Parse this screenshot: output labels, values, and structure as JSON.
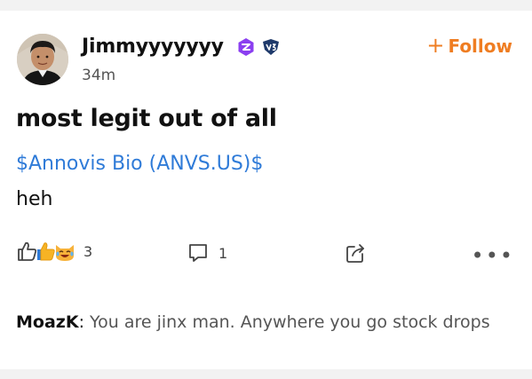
{
  "post": {
    "author": {
      "name": "Jimmyyyyyyy",
      "time": "34m",
      "badges": [
        "verified-badge-icon",
        "level-badge-icon"
      ]
    },
    "follow_label": "Follow",
    "title": "most legit out of all",
    "ticker": "$Annovis Bio (ANVS.US)$",
    "body": "heh",
    "reactions": {
      "count": "3",
      "icons": [
        "thumbs-up-outline-icon",
        "thumbs-up-emoji-icon",
        "laughing-cat-emoji-icon"
      ]
    },
    "comments": {
      "count": "1"
    },
    "top_comment": {
      "author": "MoazK",
      "text": "You are jinx man. Anywhere you go stock drops"
    }
  },
  "colors": {
    "accent_orange": "#ef7d22",
    "link_blue": "#2f7bd8",
    "badge_purple": "#8b3ff0",
    "badge_navy": "#1f3a6b"
  }
}
